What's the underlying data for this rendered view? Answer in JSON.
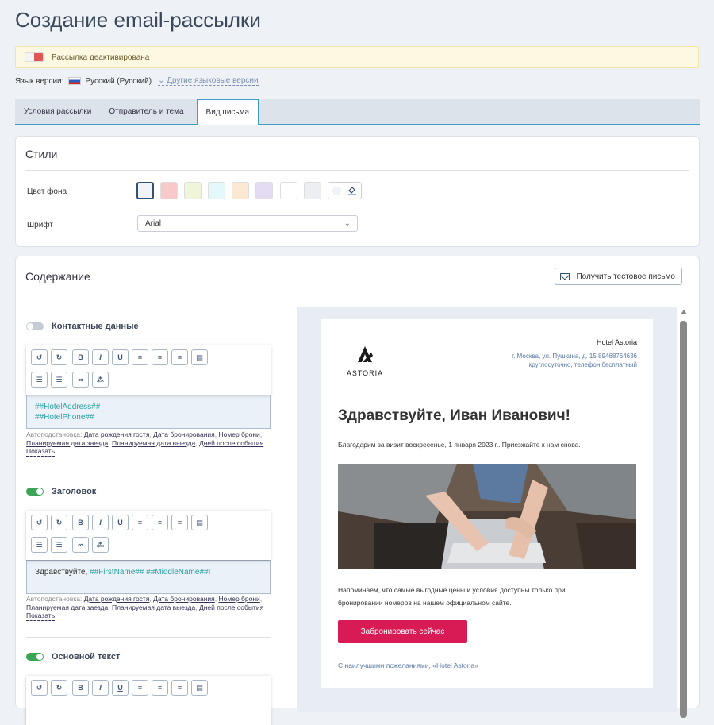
{
  "page_title": "Создание email-рассылки",
  "alert": {
    "text": "Рассылка деактивирована"
  },
  "language": {
    "label": "Язык версии:",
    "current": "Русский (Русский)",
    "other": "⌄ Другие языковые версии"
  },
  "tabs": [
    {
      "label": "Условия рассылки"
    },
    {
      "label": "Отправитель и тема"
    },
    {
      "label": "Вид письма",
      "active": true
    }
  ],
  "styles": {
    "title": "Стили",
    "bg_label": "Цвет фона",
    "font_label": "Шрифт",
    "font_value": "Arial",
    "swatches": [
      "#f0f3f7",
      "#f7c9c9",
      "#eef5d9",
      "#e4f7fa",
      "#fde8d4",
      "#e3dcf2",
      "#ffffff",
      "#eceef2"
    ]
  },
  "content": {
    "title": "Содержание",
    "test_button": "Получить тестовое письмо",
    "sections": [
      {
        "name": "Контактные данные",
        "enabled": false,
        "lines": [
          "##HotelAddress##",
          "##HotelPhone##"
        ]
      },
      {
        "name": "Заголовок",
        "enabled": true,
        "prefix": "Здравствуйте, ",
        "vars": "##FirstName## ##MiddleName##!"
      },
      {
        "name": "Основной текст",
        "enabled": true
      }
    ],
    "autofill": {
      "label": "Автоподстановка:",
      "links": [
        "Дата рождения гостя",
        "Дата бронирования",
        "Номер брони",
        "Планируемая дата заезда",
        "Планируемая дата выезда",
        "Дней после события"
      ],
      "show": "Показать"
    },
    "toolbar_icons": [
      "undo-icon",
      "redo-icon",
      "bold-icon",
      "italic-icon",
      "underline-icon",
      "align-left-icon",
      "align-center-icon",
      "align-right-icon",
      "align-justify-icon",
      "bullet-list-icon",
      "numbered-list-icon",
      "link-icon",
      "unlink-icon"
    ]
  },
  "preview": {
    "logo_text": "ASTORIA",
    "hotel_name": "Hotel Astoria",
    "hotel_info": "г. Москва, ул. Пушкина, д. 15 89468764636 круглосуточно, телефон бесплатный",
    "greeting": "Здравствуйте, Иван Иванович!",
    "thanks": "Благодарим за визит воскресенье, 1 января 2023 г.. Приезжайте к нам снова.",
    "reminder": "Напоминаем, что самые выгодные цены и условия доступны только при бронировании номеров на нашем официальном сайте.",
    "book_button": "Забронировать сейчас",
    "regards": "С наилучшими пожеланиями, «Hotel Astoria»",
    "accent_color": "#d81b55"
  }
}
